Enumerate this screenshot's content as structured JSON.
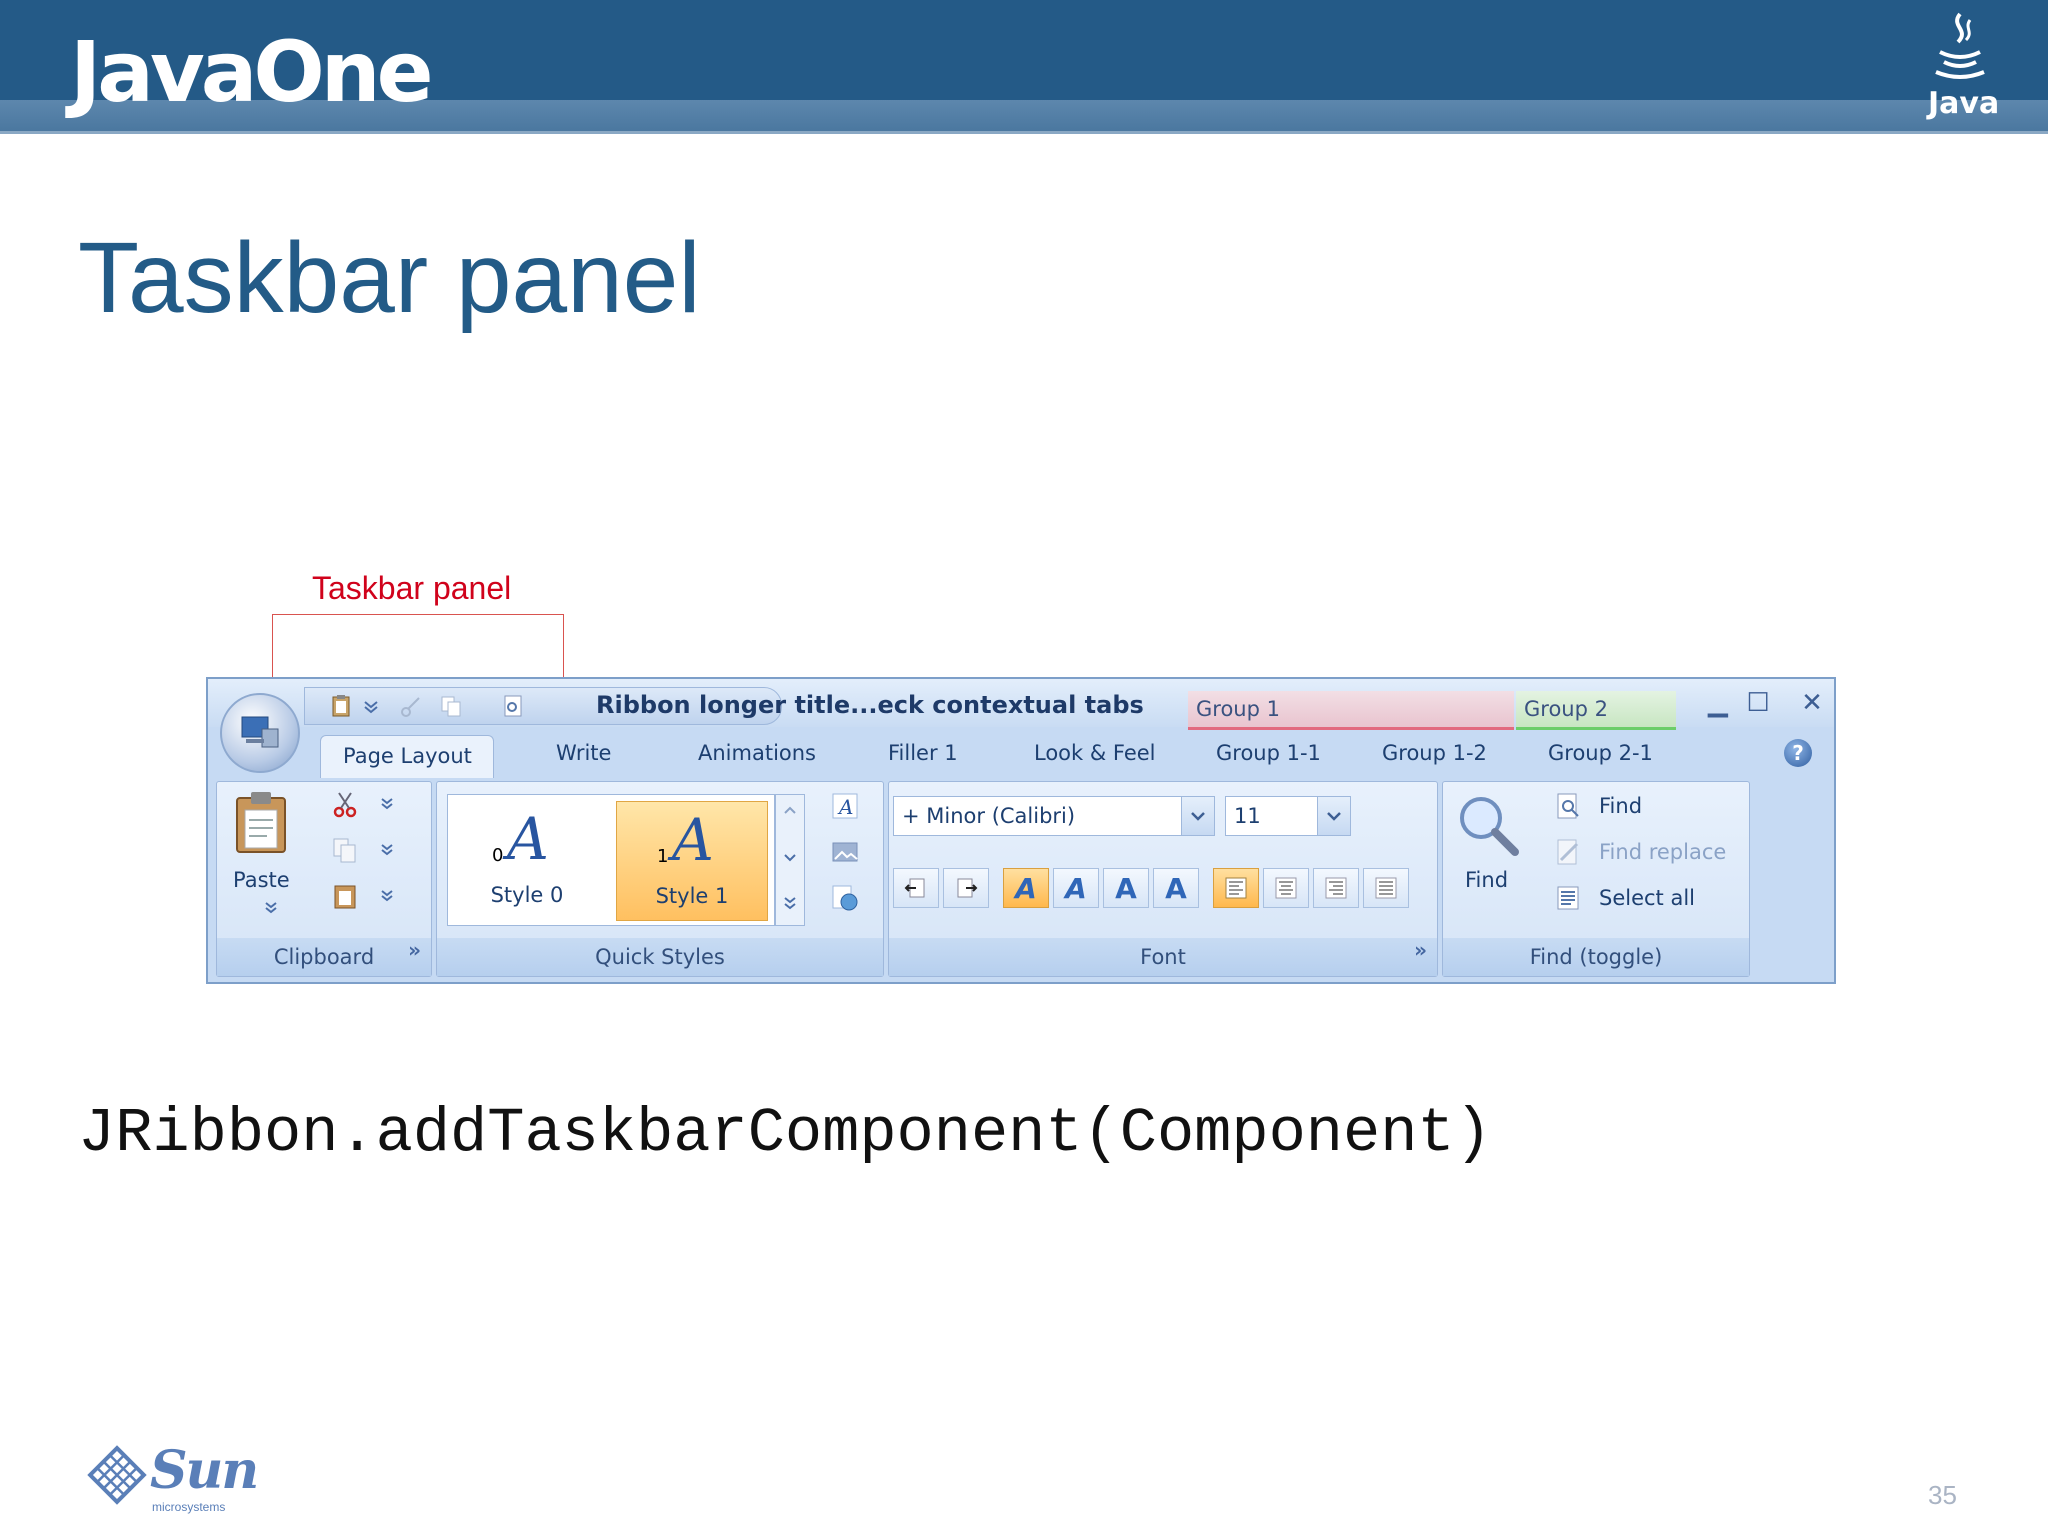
{
  "header": {
    "brand": "JavaOne",
    "java_logo_text": "Java"
  },
  "slide": {
    "title": "Taskbar panel",
    "page_number": "35"
  },
  "callout": {
    "label": "Taskbar panel"
  },
  "ribbon": {
    "title": "Ribbon longer title...eck contextual tabs",
    "contextual_groups": [
      {
        "label": "Group 1",
        "color": "#e26a7f"
      },
      {
        "label": "Group 2",
        "color": "#6ccd6a"
      }
    ],
    "tabs": [
      "Page Layout",
      "Write",
      "Animations",
      "Filler 1",
      "Look & Feel",
      "Group 1-1",
      "Group 1-2",
      "Group 2-1"
    ],
    "bands": {
      "clipboard": {
        "title": "Clipboard",
        "paste": "Paste"
      },
      "quick_styles": {
        "title": "Quick Styles",
        "styles": [
          {
            "index": "0",
            "name": "Style 0"
          },
          {
            "index": "1",
            "name": "Style 1"
          }
        ]
      },
      "font": {
        "title": "Font",
        "family": "+ Minor (Calibri)",
        "size": "11"
      },
      "find": {
        "title": "Find (toggle)",
        "find_big": "Find",
        "find": "Find",
        "find_replace": "Find replace",
        "select_all": "Select all"
      }
    }
  },
  "code": "JRibbon.addTaskbarComponent(Component)",
  "footer": {
    "sun_logo_text": "Sun",
    "sun_subtext": "microsystems"
  }
}
